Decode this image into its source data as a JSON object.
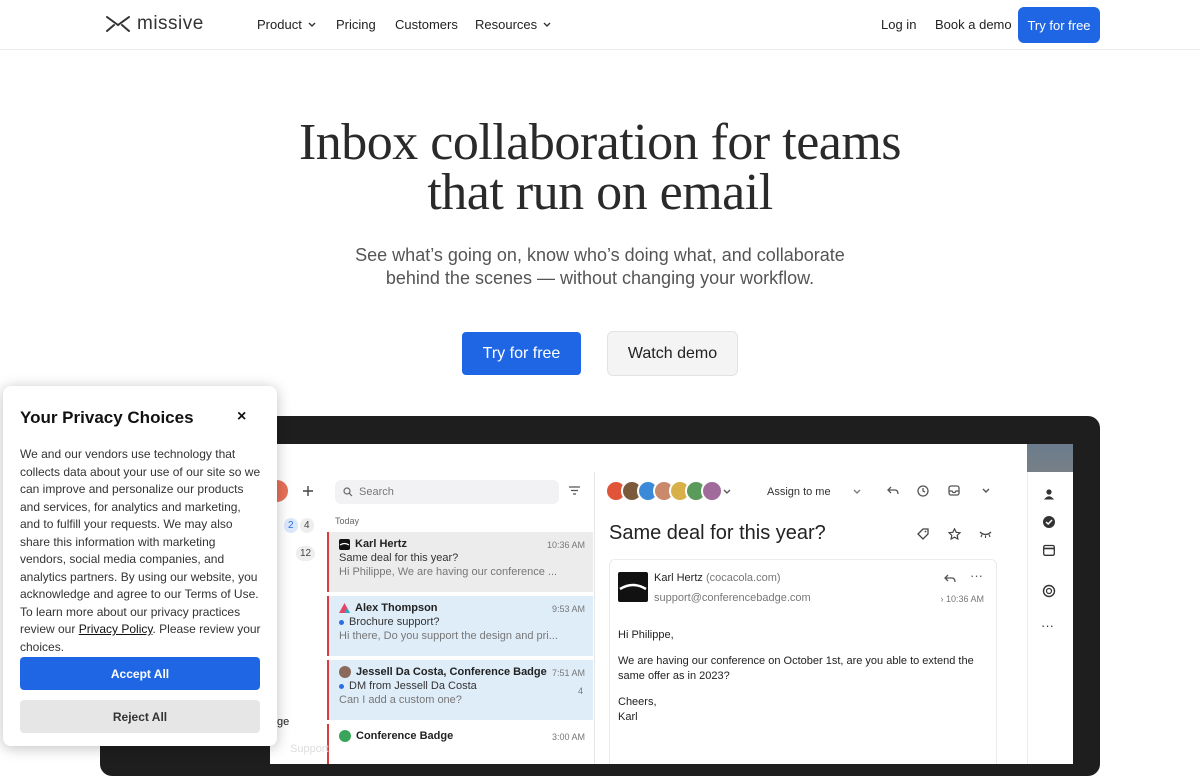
{
  "nav": {
    "logo_text": "missive",
    "product": "Product",
    "pricing": "Pricing",
    "customers": "Customers",
    "resources": "Resources",
    "login": "Log in",
    "book_demo": "Book a demo",
    "try_free": "Try for free"
  },
  "hero": {
    "title_line1": "Inbox collaboration for teams",
    "title_line2": "that run on email",
    "subtitle_line1": "See what’s going on, know who’s doing what, and collaborate",
    "subtitle_line2": "behind the scenes — without changing your workflow.",
    "cta_primary": "Try for free",
    "cta_secondary": "Watch demo"
  },
  "app": {
    "counts": [
      "2",
      "4",
      "12"
    ],
    "search_placeholder": "Search",
    "today_label": "Today",
    "conversations": [
      {
        "from": "Karl Hertz",
        "time": "10:36 AM",
        "subject": "Same deal for this year?",
        "preview": "Hi Philippe, We are having our conference ..."
      },
      {
        "from": "Alex Thompson",
        "time": "9:53 AM",
        "subject": "Brochure support?",
        "preview": "Hi there, Do you support the design and pri..."
      },
      {
        "from": "Jessell Da Costa, Conference Badge",
        "time": "7:51 AM",
        "count": "4",
        "subject": "DM from Jessell Da Costa",
        "preview": "Can I add a custom one?"
      },
      {
        "from": "Conference Badge",
        "time": "3:00 AM",
        "subject": "",
        "preview": ""
      }
    ],
    "assign_label": "Assign to me",
    "mail_title": "Same deal for this year?",
    "message": {
      "sender": "Karl Hertz",
      "org": "(cocacola.com)",
      "address": "support@conferencebadge.com",
      "time": "10:36 AM",
      "greeting": "Hi Philippe,",
      "body": "We are having our conference on October 1st, are you able to extend the same offer as in 2023?",
      "signoff1": "Cheers,",
      "signoff2": "Karl"
    },
    "left_labels": [
      "ge",
      "Support"
    ]
  },
  "privacy": {
    "title": "Your Privacy Choices",
    "close": "×",
    "text_before_link": "We and our vendors use technology that collects data about your use of our site so we can improve and personalize our products and services, for analytics and marketing, and to fulfill your requests. We may also share this information with marketing vendors, social media companies, and analytics partners. By using our website, you acknowledge and agree to our Terms of Use. To learn more about our privacy practices review our ",
    "link": "Privacy Policy",
    "text_after_link": ". Please review your choices.",
    "accept": "Accept All",
    "reject": "Reject All"
  },
  "colors": {
    "brand_blue": "#1f66e5",
    "unread_red": "#d83c3c"
  }
}
